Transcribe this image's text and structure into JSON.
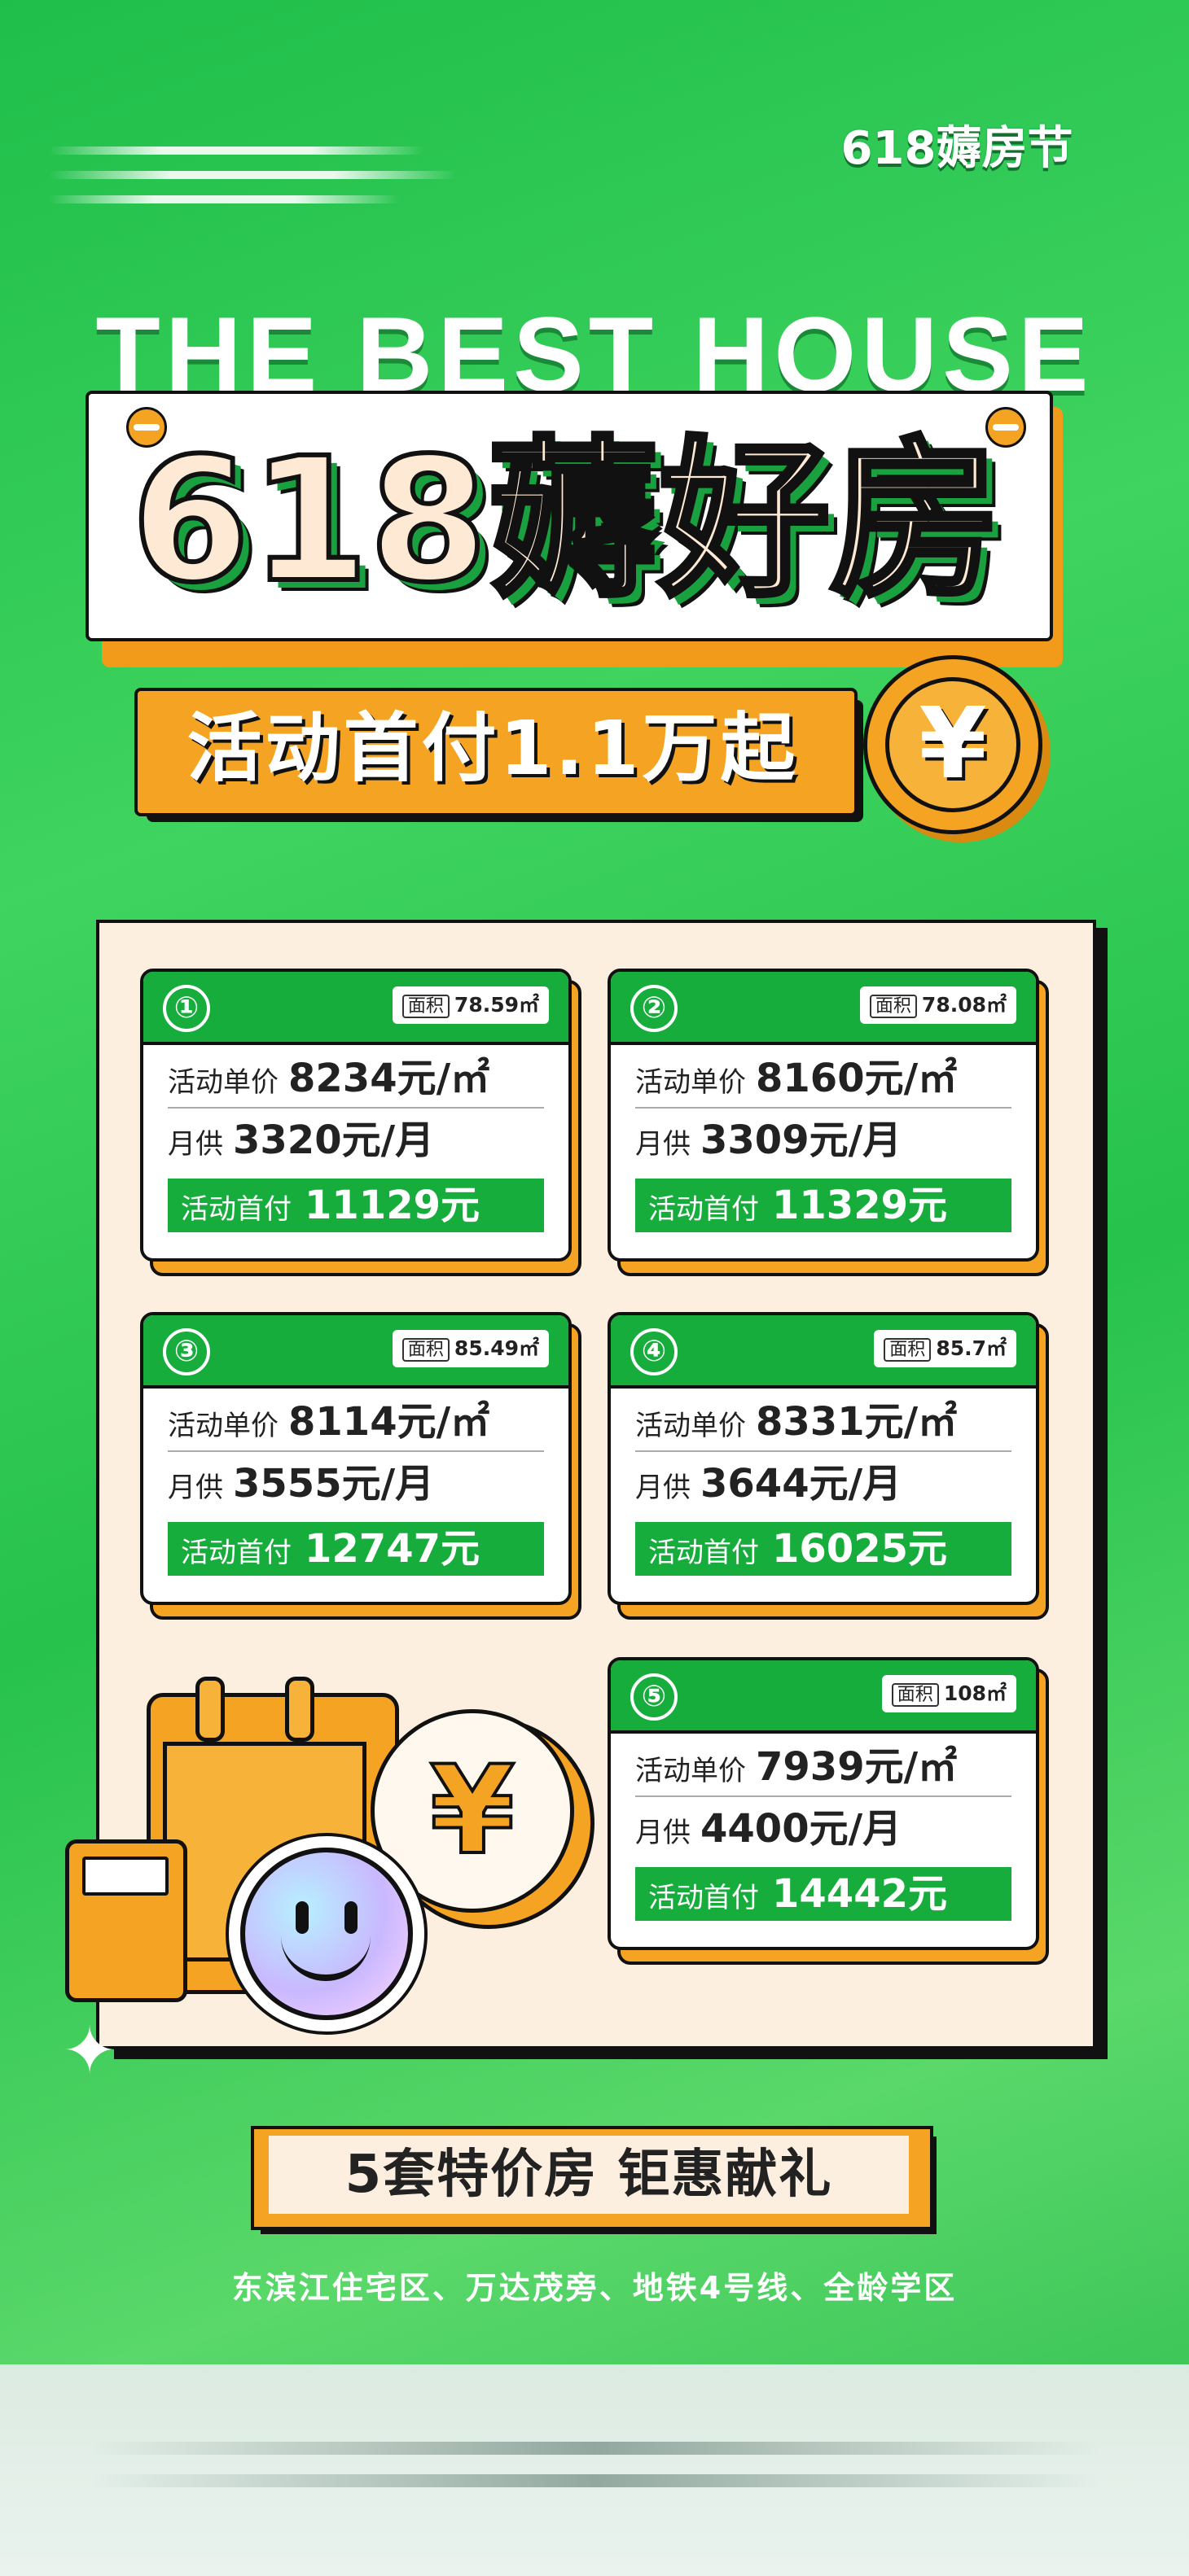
{
  "brand": "618薅房节",
  "headline": "THE BEST HOUSE",
  "title": "618薅好房",
  "subtitle": "活动首付1.1万起",
  "coin_symbol": "¥",
  "labels": {
    "area": "面积",
    "unit_price": "活动单价",
    "monthly": "月供",
    "down_payment": "活动首付"
  },
  "listings": [
    {
      "num": "①",
      "area": "78.59㎡",
      "unit_price": "8234元/㎡",
      "monthly": "3320元/月",
      "down_payment": "11129元"
    },
    {
      "num": "②",
      "area": "78.08㎡",
      "unit_price": "8160元/㎡",
      "monthly": "3309元/月",
      "down_payment": "11329元"
    },
    {
      "num": "③",
      "area": "85.49㎡",
      "unit_price": "8114元/㎡",
      "monthly": "3555元/月",
      "down_payment": "12747元"
    },
    {
      "num": "④",
      "area": "85.7㎡",
      "unit_price": "8331元/㎡",
      "monthly": "3644元/月",
      "down_payment": "16025元"
    },
    {
      "num": "⑤",
      "area": "108㎡",
      "unit_price": "7939元/㎡",
      "monthly": "4400元/月",
      "down_payment": "14442元"
    }
  ],
  "tagline": "5套特价房 钜惠献礼",
  "footer": "东滨江住宅区、万达茂旁、地铁4号线、全龄学区",
  "icons": [
    "calendar-icon",
    "calculator-icon",
    "yuan-coin-icon",
    "smiley-icon",
    "sparkle-icon"
  ],
  "colors": {
    "green": "#17ad3c",
    "orange": "#f4a322",
    "cream": "#fdefe0"
  }
}
